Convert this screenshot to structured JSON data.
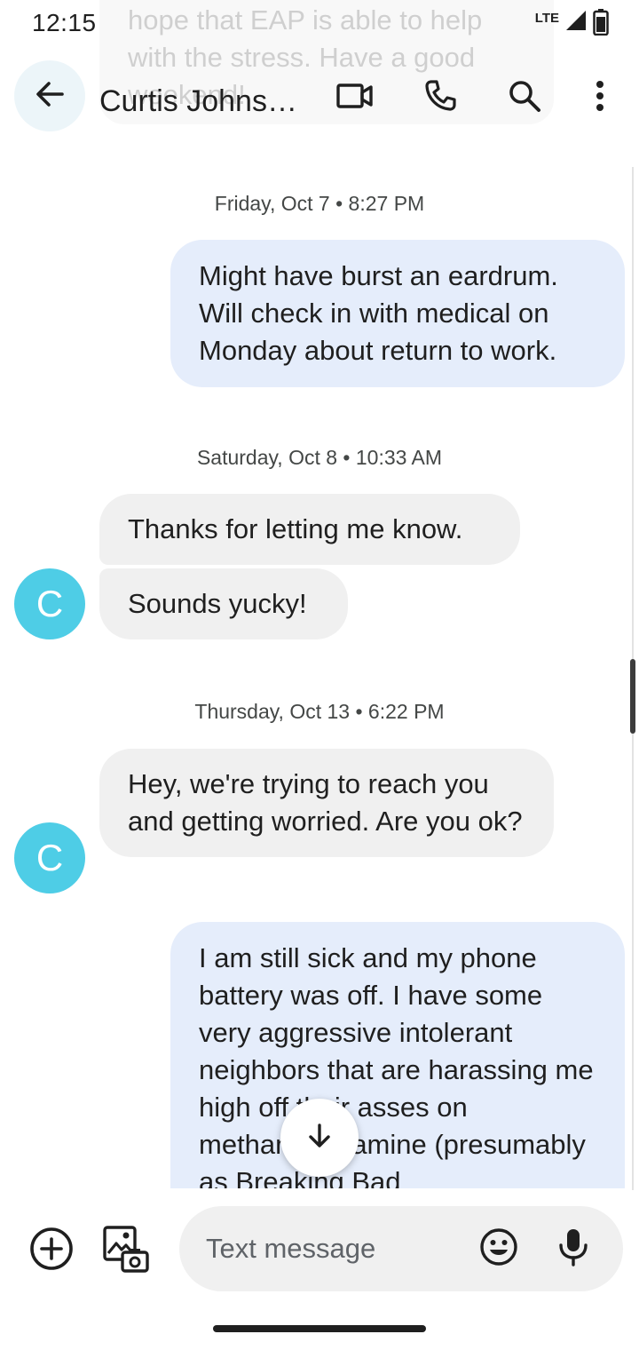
{
  "status_bar": {
    "time": "12:15",
    "network": "LTE"
  },
  "background_message": {
    "text": "hope that EAP is able to help with the stress.  Have a good weekend!"
  },
  "app_bar": {
    "contact_name": "Curtis Johns…",
    "icons": [
      "back-arrow-icon",
      "video-call-icon",
      "phone-icon",
      "search-icon",
      "more-vert-icon"
    ]
  },
  "conversation": {
    "avatar_initial": "C",
    "timestamps": [
      "Friday, Oct 7 • 8:27 PM",
      "Saturday, Oct 8 • 10:33 AM",
      "Thursday, Oct 13 • 6:22 PM"
    ],
    "messages": [
      {
        "direction": "outgoing",
        "text": "Might have burst an eardrum. Will check in with medical on Monday about return to work."
      },
      {
        "direction": "incoming",
        "text": "Thanks for letting me know."
      },
      {
        "direction": "incoming",
        "text": "Sounds yucky!"
      },
      {
        "direction": "incoming",
        "text": "Hey, we're trying to reach you and getting worried. Are you ok?"
      },
      {
        "direction": "outgoing",
        "text": "I am still sick and my phone battery was off. I have some very aggressive intolerant neighbors that are harassing me high off their asses on methamphetamine (presumably as Breaking Bad"
      }
    ]
  },
  "compose": {
    "placeholder": "Text message",
    "icons": [
      "add-circle-icon",
      "gallery-camera-icon",
      "emoji-icon",
      "mic-icon"
    ]
  },
  "colors": {
    "outgoing_bubble": "#e5edfb",
    "incoming_bubble": "#f0f0f0",
    "avatar": "#4ecde6"
  }
}
